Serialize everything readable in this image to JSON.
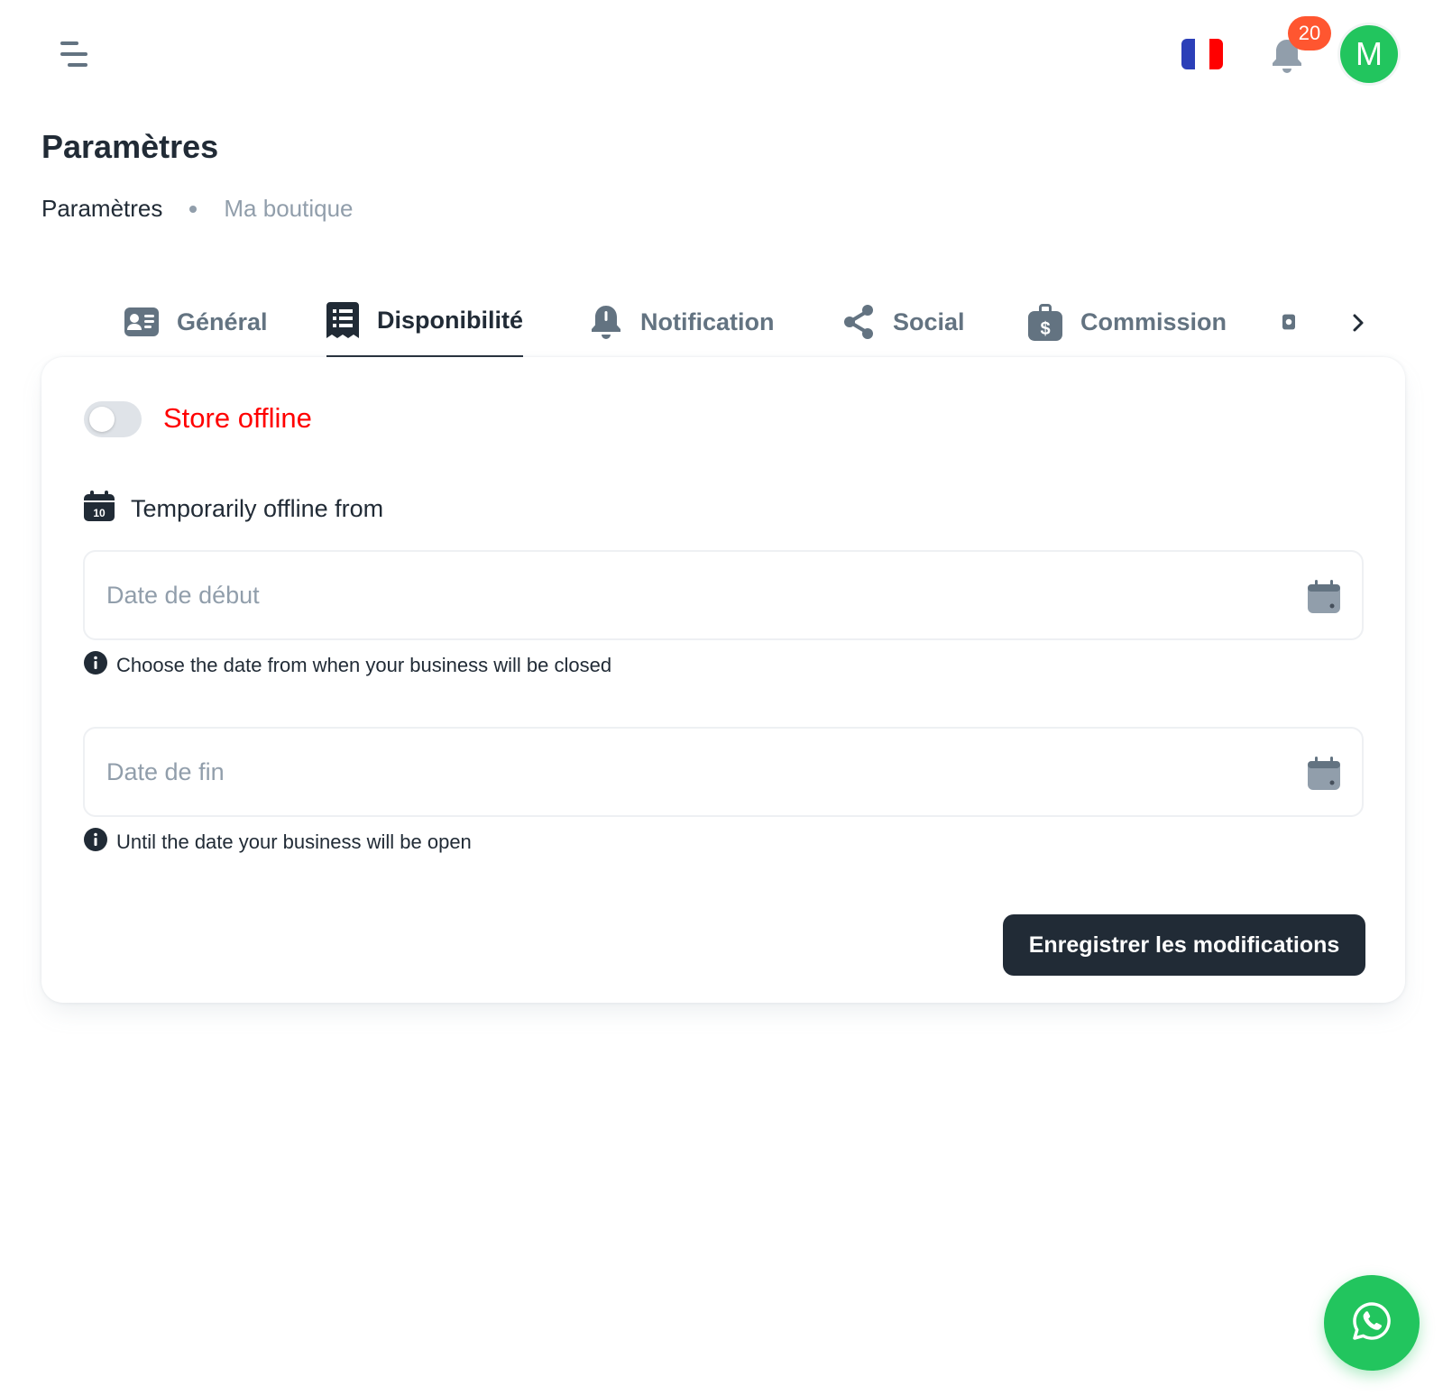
{
  "header": {
    "menu_icon": "menu-icon",
    "language": {
      "code": "fr",
      "icon": "flag-fr-icon",
      "colors": [
        "#2b3fb8",
        "#ffffff",
        "#ff0000"
      ]
    },
    "notifications": {
      "icon": "bell-icon",
      "count": "20"
    },
    "avatar": {
      "initial": "M",
      "color": "#22c55e"
    }
  },
  "page": {
    "title": "Paramètres",
    "breadcrumb": [
      "Paramètres",
      "Ma boutique"
    ]
  },
  "tabs": [
    {
      "label": "Général",
      "icon": "id-card-icon",
      "active": false
    },
    {
      "label": "Disponibilité",
      "icon": "list-receipt-icon",
      "active": true
    },
    {
      "label": "Notification",
      "icon": "bell-icon",
      "active": false
    },
    {
      "label": "Social",
      "icon": "share-icon",
      "active": false
    },
    {
      "label": "Commission",
      "icon": "money-bag-icon",
      "active": false
    }
  ],
  "tabs_scroll_icon": "chevron-right-icon",
  "availability": {
    "toggle": {
      "label": "Store offline",
      "checked": false,
      "label_color": "#ff0000"
    },
    "section_title": "Temporarily offline from",
    "section_icon": "calendar-10-icon",
    "start_date": {
      "value": "",
      "placeholder": "Date de début",
      "helper": "Choose the date from when your business will be closed"
    },
    "end_date": {
      "value": "",
      "placeholder": "Date de fin",
      "helper": "Until the date your business will be open"
    },
    "save_label": "Enregistrer les modifications"
  },
  "fab": {
    "icon": "whatsapp-icon",
    "color": "#22c55e"
  }
}
